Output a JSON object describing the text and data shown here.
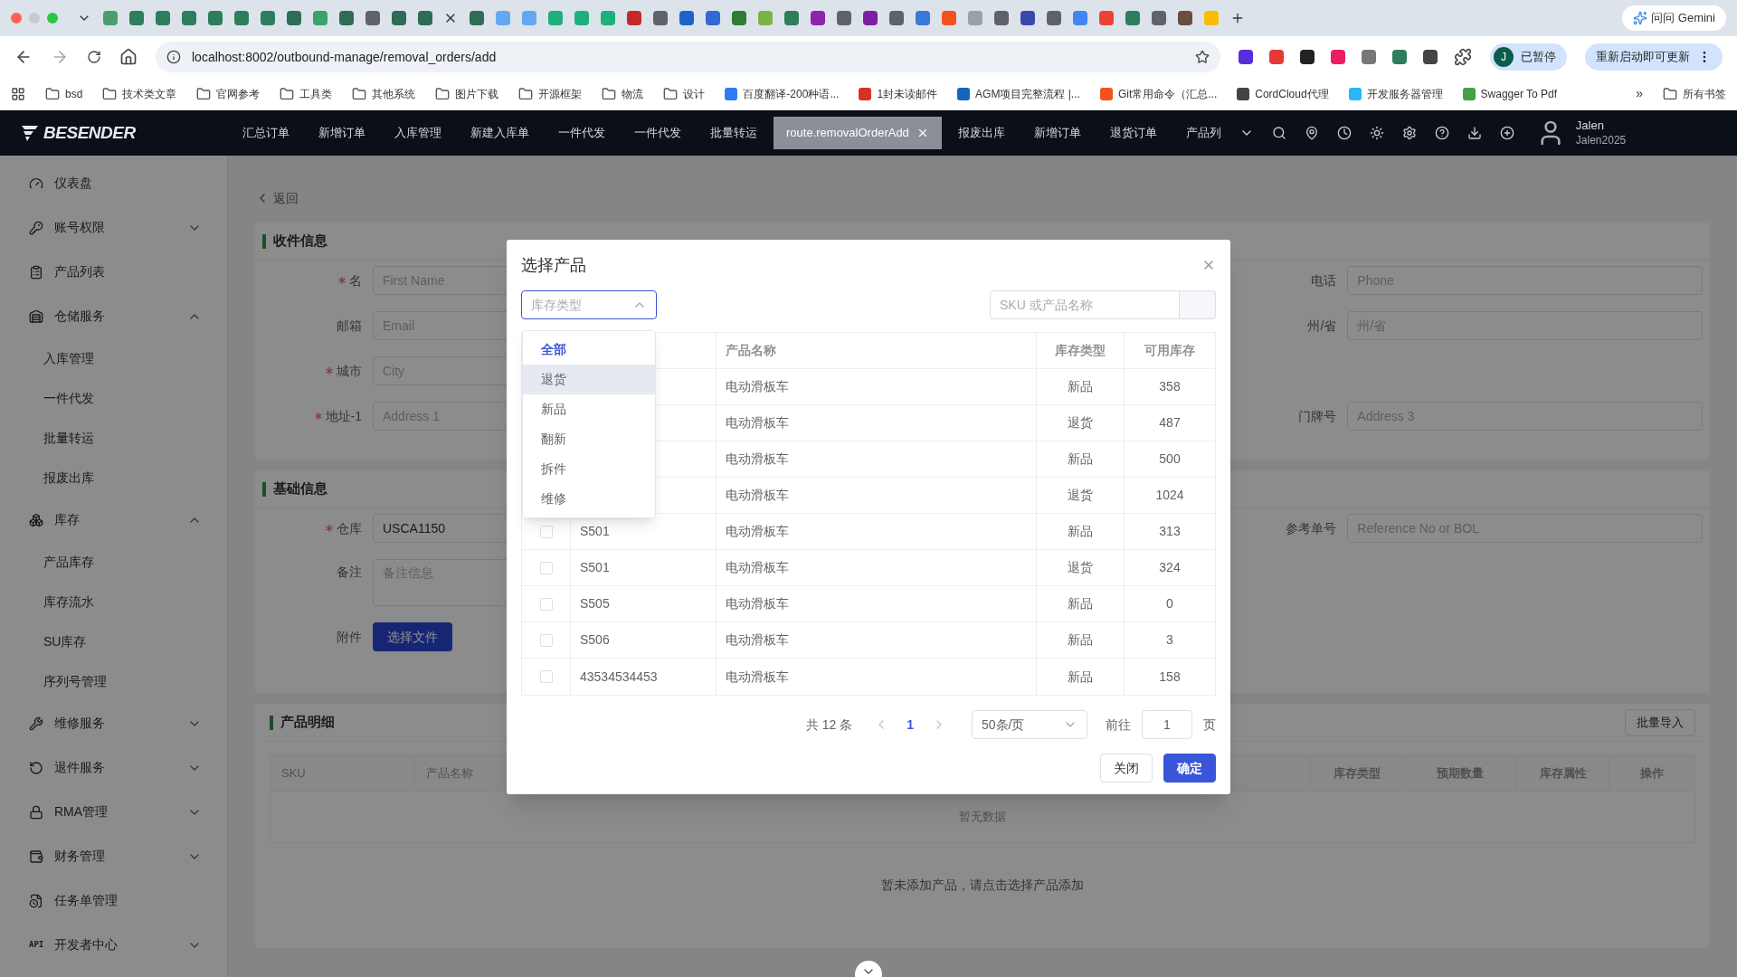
{
  "browser": {
    "url": "localhost:8002/outbound-manage/removal_orders/add",
    "gemini": "问问 Gemini",
    "profile_status": "已暂停",
    "profile_initial": "J",
    "update_button": "重新启动即可更新",
    "more_bookmarks": "»",
    "all_bookmarks": "所有书签",
    "bookmarks": [
      {
        "kind": "folder",
        "label": "bsd"
      },
      {
        "kind": "folder",
        "label": "技术类文章"
      },
      {
        "kind": "folder",
        "label": "官网参考"
      },
      {
        "kind": "folder",
        "label": "工具类"
      },
      {
        "kind": "folder",
        "label": "其他系统"
      },
      {
        "kind": "folder",
        "label": "图片下载"
      },
      {
        "kind": "folder",
        "label": "开源框架"
      },
      {
        "kind": "folder",
        "label": "物流"
      },
      {
        "kind": "folder",
        "label": "设计"
      },
      {
        "kind": "site",
        "label": "百度翻译-200种语...",
        "color": "#2b7cf6"
      },
      {
        "kind": "site",
        "label": "1封未读邮件",
        "color": "#d93025"
      },
      {
        "kind": "site",
        "label": "AGM项目完整流程 |...",
        "color": "#1565c0"
      },
      {
        "kind": "site",
        "label": "Git常用命令（汇总...",
        "color": "#f4511e"
      },
      {
        "kind": "site",
        "label": "CordCloud代理",
        "color": "#444444"
      },
      {
        "kind": "site",
        "label": "开发服务器管理",
        "color": "#29b6f6"
      },
      {
        "kind": "site",
        "label": "Swagger To Pdf",
        "color": "#43a047"
      }
    ]
  },
  "header": {
    "brand": "BESENDER",
    "tabs": [
      {
        "label": "汇总订单",
        "selected": false
      },
      {
        "label": "新增订单",
        "selected": false
      },
      {
        "label": "入库管理",
        "selected": false
      },
      {
        "label": "新建入库单",
        "selected": false
      },
      {
        "label": "一件代发",
        "selected": false
      },
      {
        "label": "一件代发",
        "selected": false
      },
      {
        "label": "批量转运",
        "selected": false
      },
      {
        "label": "route.removalOrderAdd",
        "selected": true
      },
      {
        "label": "报废出库",
        "selected": false
      },
      {
        "label": "新增订单",
        "selected": false
      },
      {
        "label": "退货订单",
        "selected": false
      },
      {
        "label": "产品列",
        "selected": false
      }
    ],
    "user": {
      "name": "Jalen",
      "account": "Jalen2025"
    }
  },
  "sidebar": {
    "items": [
      {
        "label": "仪表盘"
      },
      {
        "label": "账号权限",
        "expanded": false
      },
      {
        "label": "产品列表"
      },
      {
        "label": "仓储服务",
        "expanded": true,
        "children": [
          {
            "label": "入库管理"
          },
          {
            "label": "一件代发"
          },
          {
            "label": "批量转运"
          },
          {
            "label": "报废出库"
          }
        ]
      },
      {
        "label": "库存",
        "expanded": true,
        "children": [
          {
            "label": "产品库存"
          },
          {
            "label": "库存流水"
          },
          {
            "label": "SU库存"
          },
          {
            "label": "序列号管理"
          }
        ]
      },
      {
        "label": "维修服务",
        "expanded": false
      },
      {
        "label": "退件服务",
        "expanded": false
      },
      {
        "label": "RMA管理",
        "expanded": false
      },
      {
        "label": "财务管理",
        "expanded": false
      },
      {
        "label": "任务单管理"
      },
      {
        "label": "开发者中心",
        "expanded": false,
        "icon_text": "API"
      }
    ]
  },
  "form": {
    "back": "返回",
    "recipient": {
      "title": "收件信息",
      "left": [
        {
          "label": "名",
          "required": true,
          "placeholder": "First Name"
        },
        {
          "label": "邮箱",
          "required": false,
          "placeholder": "Email"
        },
        {
          "label": "城市",
          "required": true,
          "placeholder": "City"
        },
        {
          "label": "地址-1",
          "required": true,
          "placeholder": "Address 1"
        }
      ],
      "right": [
        {
          "label": "电话",
          "required": false,
          "placeholder": "Phone"
        },
        {
          "label": "州/省",
          "required": false,
          "placeholder": "州/省"
        },
        {
          "kind": "empty"
        },
        {
          "label": "门牌号",
          "required": false,
          "placeholder": "Address 3"
        }
      ]
    },
    "basic": {
      "title": "基础信息",
      "warehouse": {
        "label": "仓库",
        "required": true,
        "value": "USCA1150"
      },
      "remark": {
        "label": "备注",
        "placeholder": "备注信息"
      },
      "attachment": {
        "label": "附件",
        "button": "选择文件"
      },
      "reference": {
        "label": "参考单号",
        "placeholder": "Reference No or BOL"
      }
    },
    "products": {
      "title": "产品明细",
      "import_button": "批量导入",
      "columns_left": [
        "SKU",
        "产品名称"
      ],
      "columns_right": [
        "库存类型",
        "预期数量",
        "库存属性",
        "操作"
      ],
      "empty": "暂无数据",
      "hint": "暂未添加产品，请点击选择产品添加"
    }
  },
  "modal": {
    "title": "选择产品",
    "stock_type": {
      "placeholder": "库存类型",
      "open": true,
      "options": [
        {
          "label": "全部",
          "selected": true,
          "hovered": false
        },
        {
          "label": "退货",
          "selected": false,
          "hovered": true
        },
        {
          "label": "新品",
          "selected": false,
          "hovered": false
        },
        {
          "label": "翻新",
          "selected": false,
          "hovered": false
        },
        {
          "label": "拆件",
          "selected": false,
          "hovered": false
        },
        {
          "label": "维修",
          "selected": false,
          "hovered": false
        }
      ]
    },
    "search": {
      "placeholder": "SKU 或产品名称"
    },
    "columns": [
      "产品名称",
      "库存类型",
      "可用库存"
    ],
    "rows": [
      {
        "name": "电动滑板车",
        "type": "新品",
        "stock": "358"
      },
      {
        "name": "电动滑板车",
        "type": "退货",
        "stock": "487"
      },
      {
        "name": "电动滑板车",
        "type": "新品",
        "stock": "500"
      },
      {
        "name": "电动滑板车",
        "type": "退货",
        "stock": "1024"
      },
      {
        "checked": false,
        "sku": "S501",
        "name": "电动滑板车",
        "type": "新品",
        "stock": "313"
      },
      {
        "checked": false,
        "sku": "S501",
        "name": "电动滑板车",
        "type": "退货",
        "stock": "324"
      },
      {
        "checked": false,
        "sku": "S505",
        "name": "电动滑板车",
        "type": "新品",
        "stock": "0"
      },
      {
        "checked": false,
        "sku": "S506",
        "name": "电动滑板车",
        "type": "新品",
        "stock": "3"
      },
      {
        "checked": false,
        "sku": "43534534453",
        "name": "电动滑板车",
        "type": "新品",
        "stock": "158"
      }
    ],
    "pagination": {
      "total": "共 12 条",
      "pages": [
        {
          "label": "1",
          "selected": true
        }
      ],
      "page_size": "50条/页",
      "goto_label": "前往",
      "goto_value": "1",
      "page_unit": "页"
    },
    "buttons": [
      {
        "kind": "default",
        "label": "关闭"
      },
      {
        "kind": "primary",
        "label": "确定"
      }
    ]
  }
}
